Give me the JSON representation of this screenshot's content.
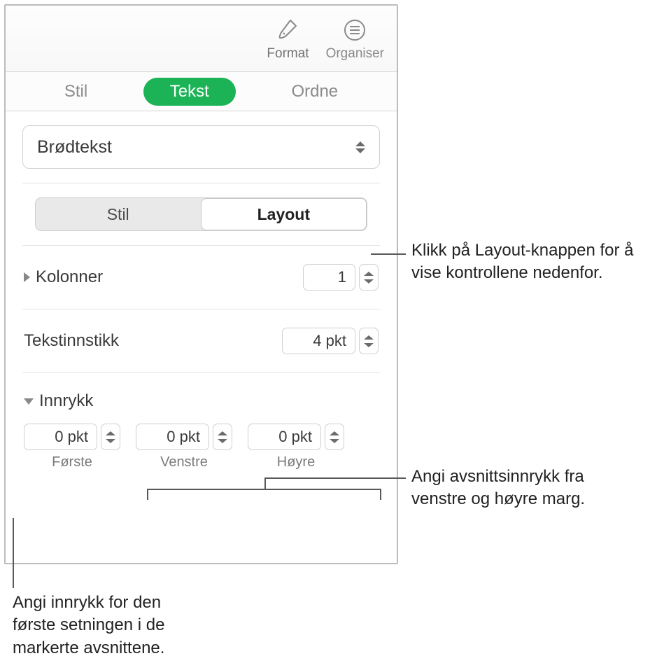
{
  "toolbar": {
    "format": "Format",
    "organiser": "Organiser"
  },
  "tabs": {
    "stil": "Stil",
    "tekst": "Tekst",
    "ordne": "Ordne"
  },
  "paragraph_style": "Brødtekst",
  "segmented": {
    "stil": "Stil",
    "layout": "Layout"
  },
  "columns": {
    "label": "Kolonner",
    "value": "1"
  },
  "textinset": {
    "label": "Tekstinnstikk",
    "value": "4 pkt"
  },
  "indent": {
    "label": "Innrykk",
    "first": {
      "value": "0 pkt",
      "label": "Første"
    },
    "left": {
      "value": "0 pkt",
      "label": "Venstre"
    },
    "right": {
      "value": "0 pkt",
      "label": "Høyre"
    }
  },
  "callouts": {
    "layout": "Klikk på Layout-knappen for å vise kontrollene nedenfor.",
    "margins": "Angi avsnittsinnrykk fra venstre og høyre marg.",
    "first": "Angi innrykk for den første setningen i de markerte avsnittene."
  }
}
